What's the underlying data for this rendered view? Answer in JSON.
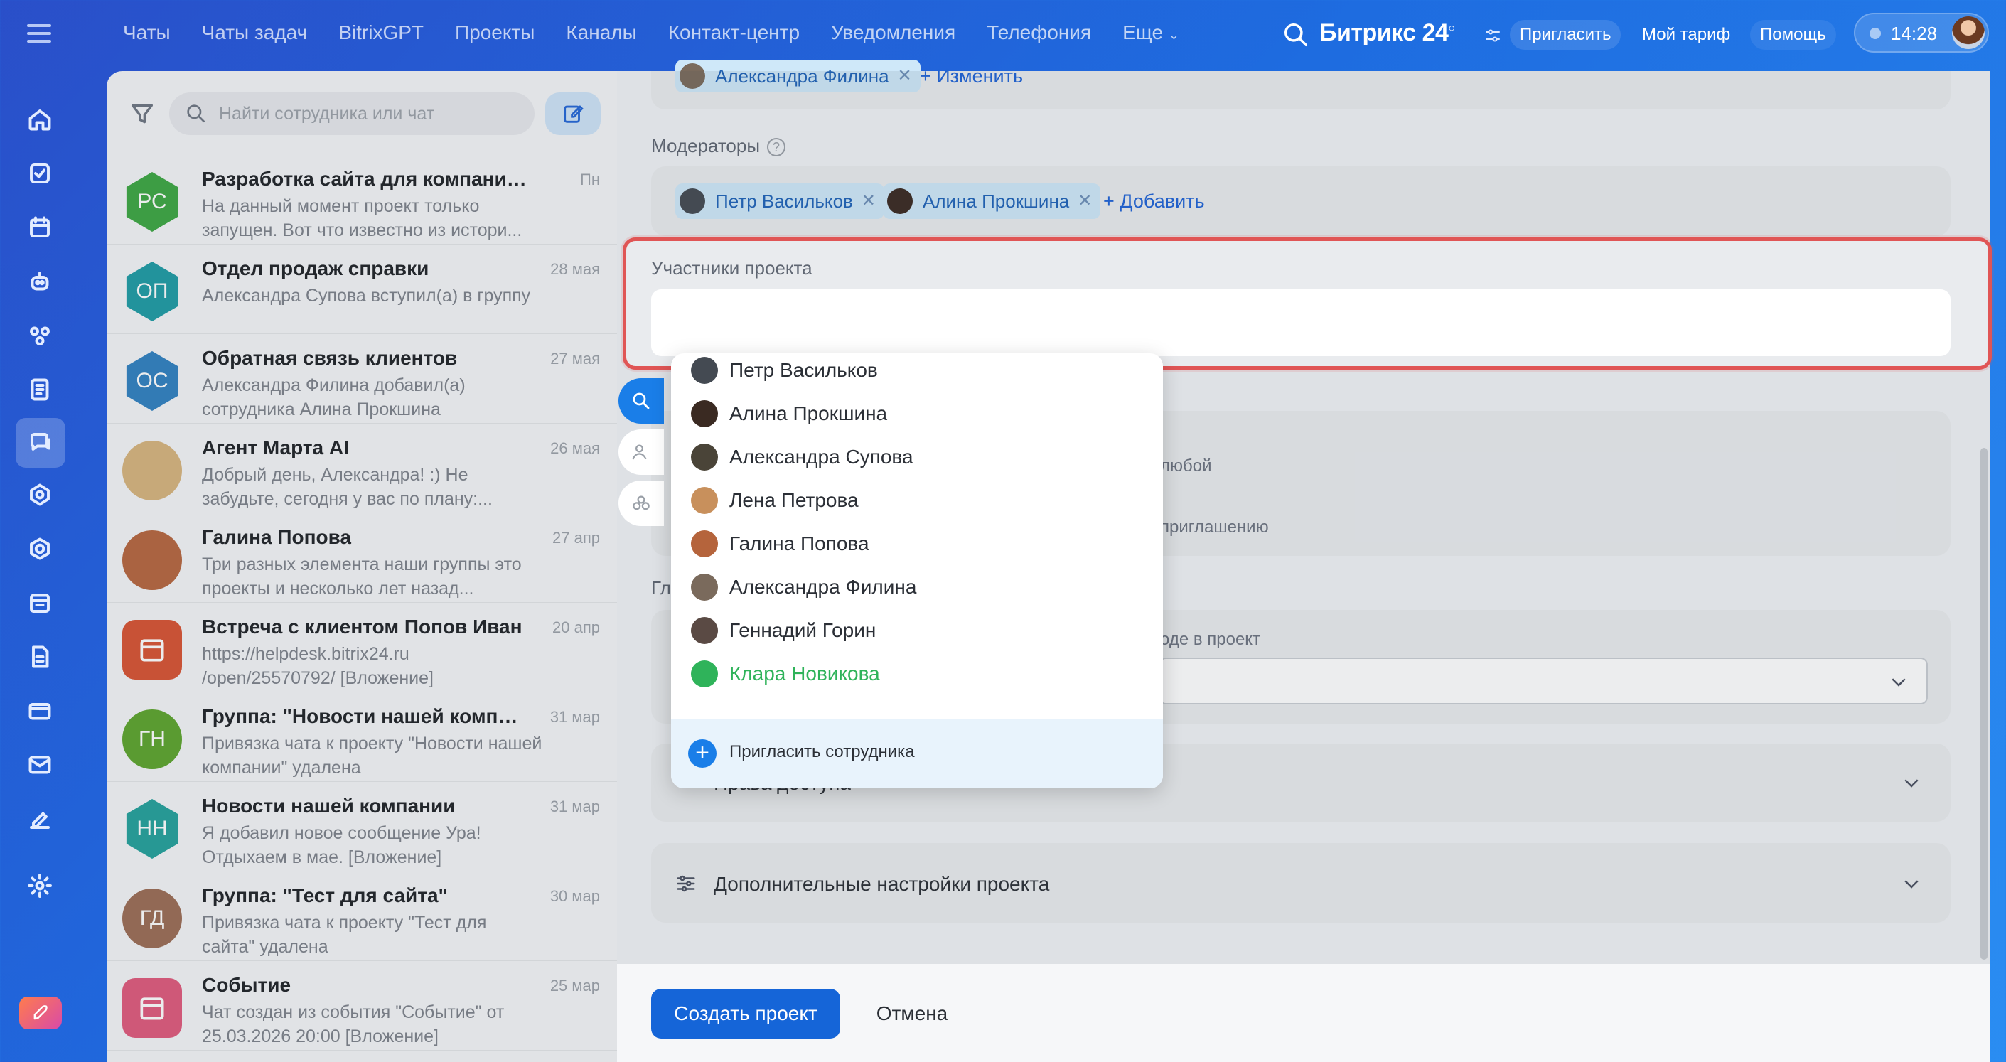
{
  "topbar": {
    "nav": [
      "Чаты",
      "Чаты задач",
      "BitrixGPT",
      "Проекты",
      "Каналы",
      "Контакт-центр",
      "Уведомления",
      "Телефония",
      "Еще"
    ],
    "brand": "Битрикс 24",
    "invite": "Пригласить",
    "tariff": "Мой тариф",
    "help": "Помощь",
    "time": "14:28"
  },
  "chatpane": {
    "search_placeholder": "Найти сотрудника или чат",
    "chats": [
      {
        "name": "Разработка сайта для компании Сф...",
        "preview": "На данный момент проект только запущен. Вот что известно из истори...",
        "date": "Пн",
        "initials": "РС",
        "color": "#3aa53f",
        "shape": "hex"
      },
      {
        "name": "Отдел продаж справки",
        "preview": "Александра Супова вступил(а) в группу",
        "date": "28 мая",
        "initials": "ОП",
        "color": "#1b9aa3",
        "shape": "hex"
      },
      {
        "name": "Обратная связь клиентов",
        "preview": "Александра Филина добавил(а) сотрудника Алина Прокшина",
        "date": "27 мая",
        "initials": "ОС",
        "color": "#2d7fc0",
        "shape": "hex"
      },
      {
        "name": "Агент Марта AI",
        "preview": "Добрый день, Александра! :) Не забудьте, сегодня у вас по плану:...",
        "date": "26 мая",
        "initials": "",
        "color": "#d7b37c",
        "shape": "round"
      },
      {
        "name": "Галина Попова",
        "preview": "Три разных элемента наши группы это проекты и несколько лет назад...",
        "date": "27 апр",
        "initials": "",
        "color": "#b5643c",
        "shape": "round"
      },
      {
        "name": "Встреча с клиентом Попов Иван",
        "preview": "https://helpdesk.bitrix24.ru /open/25570792/ [Вложение]",
        "date": "20 апр",
        "initials": "",
        "color": "#d8502f",
        "shape": "sq"
      },
      {
        "name": "Группа: \"Новости нашей компан...",
        "preview": "Привязка чата к проекту \"Новости нашей компании\" удалена",
        "date": "31 мар",
        "initials": "ГН",
        "color": "#5aa32a",
        "shape": "round"
      },
      {
        "name": "Новости нашей компании",
        "preview": "Я добавил новое сообщение Ура! Отдыхаем в мае. [Вложение]",
        "date": "31 мар",
        "initials": "НН",
        "color": "#20a09a",
        "shape": "hex"
      },
      {
        "name": "Группа: \"Тест для сайта\"",
        "preview": "Привязка чата к проекту \"Тест для сайта\" удалена",
        "date": "30 мар",
        "initials": "ГД",
        "color": "#9a6a52",
        "shape": "round"
      },
      {
        "name": "Событие",
        "preview": "Чат создан из события \"Событие\" от 25.03.2026 20:00 [Вложение]",
        "date": "25 мар",
        "initials": "",
        "color": "#e0577a",
        "shape": "sq"
      }
    ]
  },
  "form": {
    "owner_tag": "Александра Филина",
    "change_link": "+ Изменить",
    "moderators_label": "Модераторы",
    "moderators": [
      "Петр Васильков",
      "Алина Прокшина"
    ],
    "add_link": "+ Добавить",
    "members_label": "Участники проекта",
    "frag_any": "любой",
    "frag_invite": "приглашению",
    "frag_gl": "Гл",
    "frag_entry": "оде в проект",
    "access_label": "Права доступа",
    "extra_label": "Дополнительные настройки проекта",
    "create_button": "Создать проект",
    "cancel_button": "Отмена"
  },
  "dropdown": {
    "people": [
      {
        "name": "Петр Васильков",
        "color": "#444a52"
      },
      {
        "name": "Алина Прокшина",
        "color": "#3a2a22"
      },
      {
        "name": "Александра Супова",
        "color": "#4a4438"
      },
      {
        "name": "Лена Петрова",
        "color": "#c8905c"
      },
      {
        "name": "Галина Попова",
        "color": "#b5643c"
      },
      {
        "name": "Александра Филина",
        "color": "#7a6a5c"
      },
      {
        "name": "Геннадий Горин",
        "color": "#5a4a44"
      },
      {
        "name": "Клара Новикова",
        "color": "#2fb35a",
        "highlight": true
      }
    ],
    "invite_label": "Пригласить сотрудника"
  }
}
